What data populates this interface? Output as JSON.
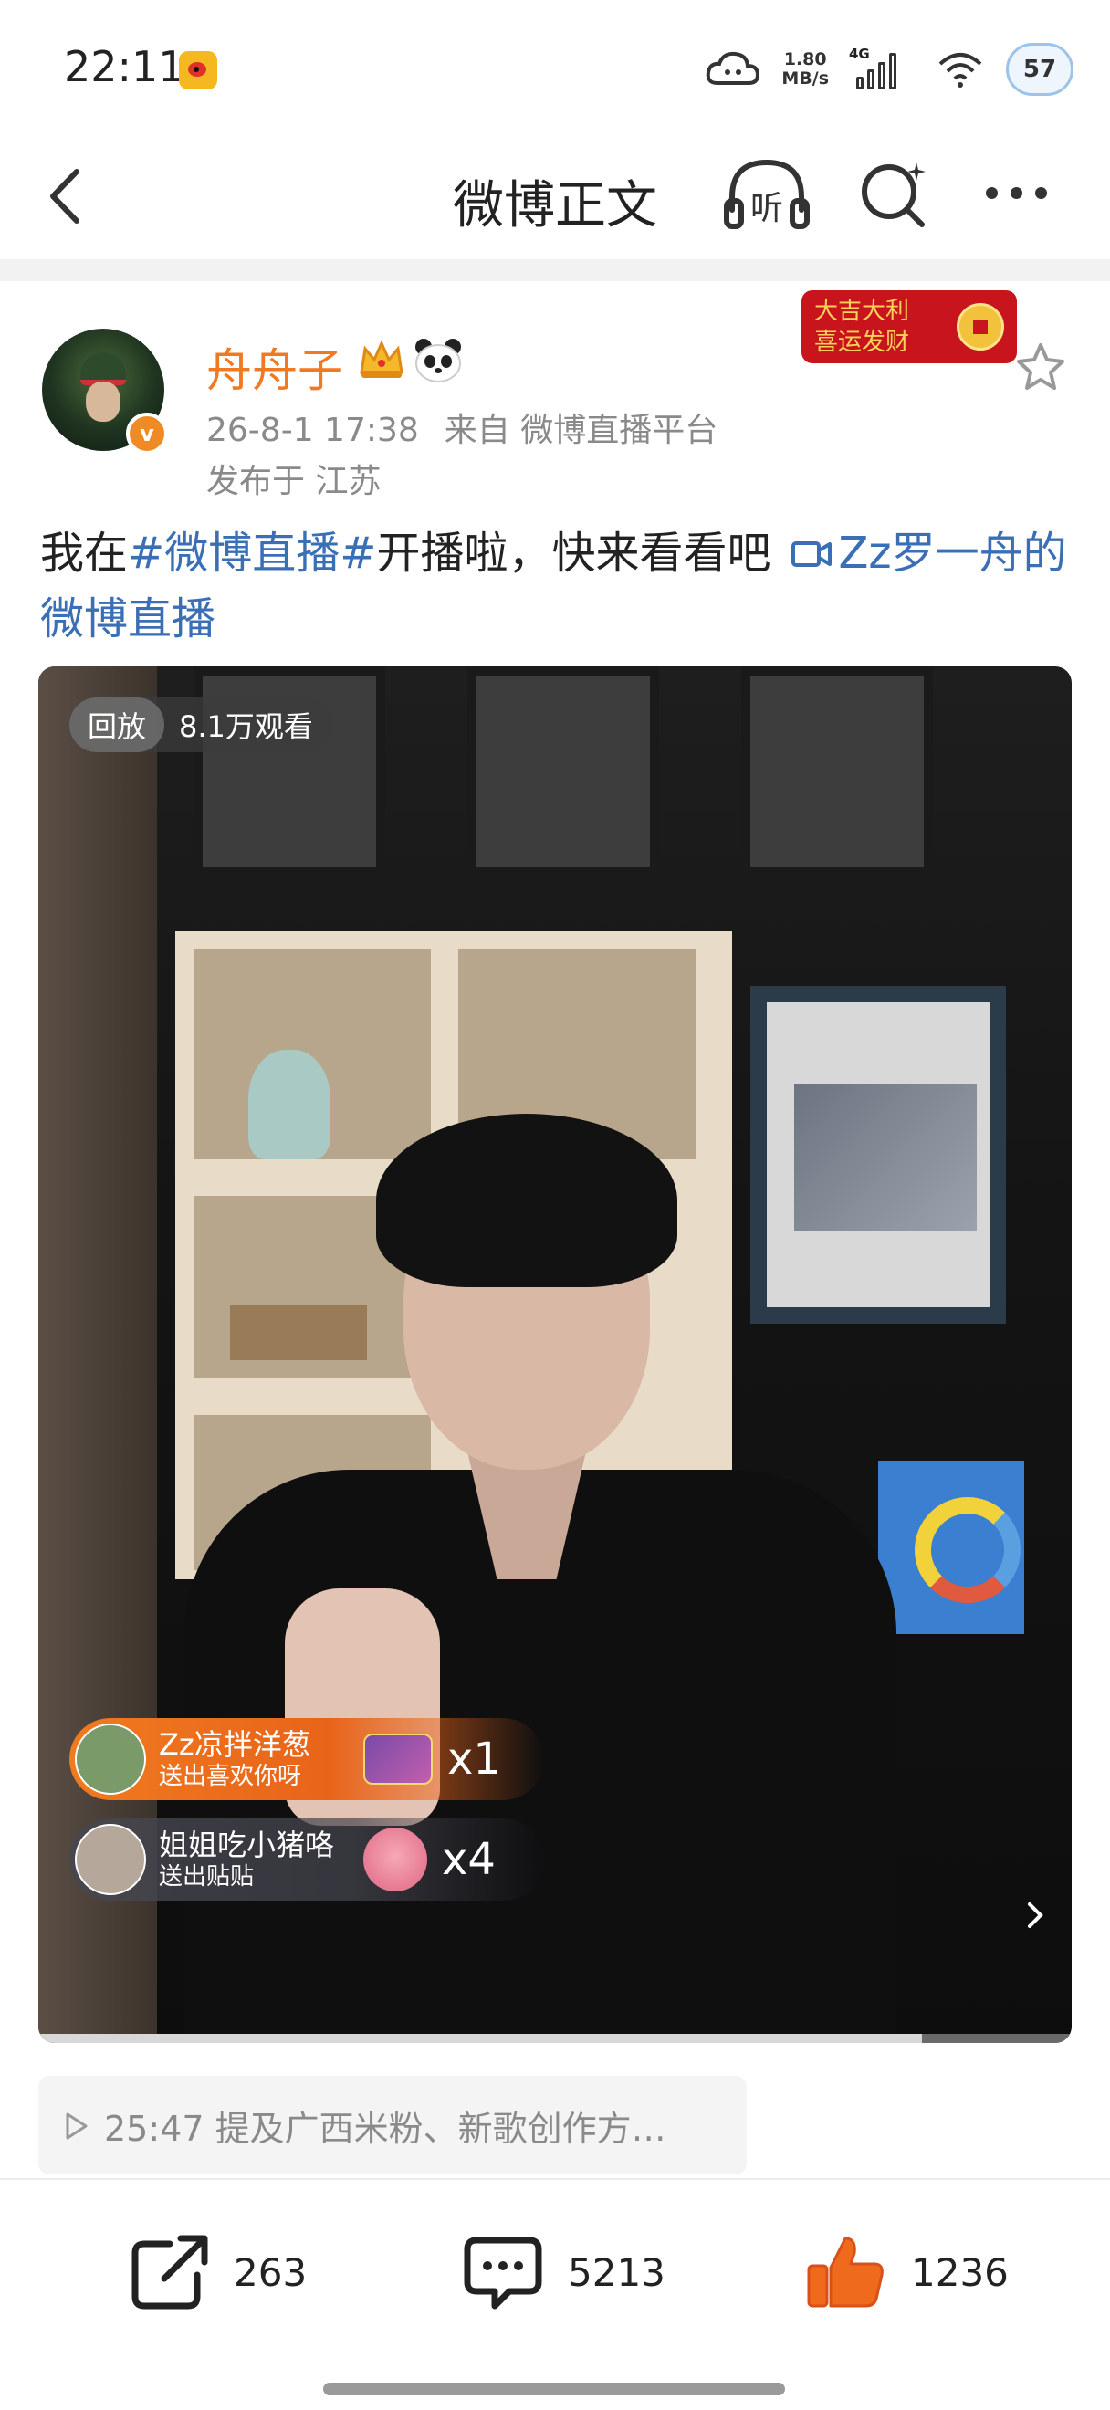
{
  "status_bar": {
    "time": "22:11",
    "net_speed_value": "1.80",
    "net_speed_unit": "MB/s",
    "network_type": "4G",
    "battery": "57"
  },
  "nav": {
    "title": "微博正文",
    "listen_label": "听"
  },
  "post": {
    "author": "舟舟子",
    "verified_mark": "v",
    "date": "26-8-1 17:38",
    "source": "来自 微博直播平台",
    "location": "发布于 江苏",
    "promo_badge_line1": "大吉大利",
    "promo_badge_line2": "喜运发财",
    "text_before": "我在",
    "hashtag": "#微博直播#",
    "text_after": "开播啦，快来看看吧",
    "live_link": "Zz罗一舟的微博直播"
  },
  "video": {
    "replay_label": "回放",
    "views": "8.1万观看",
    "progress_fraction": 0.855,
    "gifts": [
      {
        "sender": "Zz凉拌洋葱",
        "action": "送出喜欢你呀",
        "gift_tag": "喜欢你呀",
        "count": "x1"
      },
      {
        "sender": "姐姐吃小猪咯",
        "action": "送出贴贴",
        "gift_tag": "",
        "count": "x4"
      }
    ]
  },
  "summary": {
    "text": "25:47 提及广西米粉、新歌创作方…"
  },
  "actions": {
    "repost_count": "263",
    "comment_count": "5213",
    "like_count": "1236"
  },
  "colors": {
    "username": "#f07a22",
    "link": "#3a6fb5",
    "like": "#f06a1e",
    "meta_gray": "#8a8a8a"
  }
}
